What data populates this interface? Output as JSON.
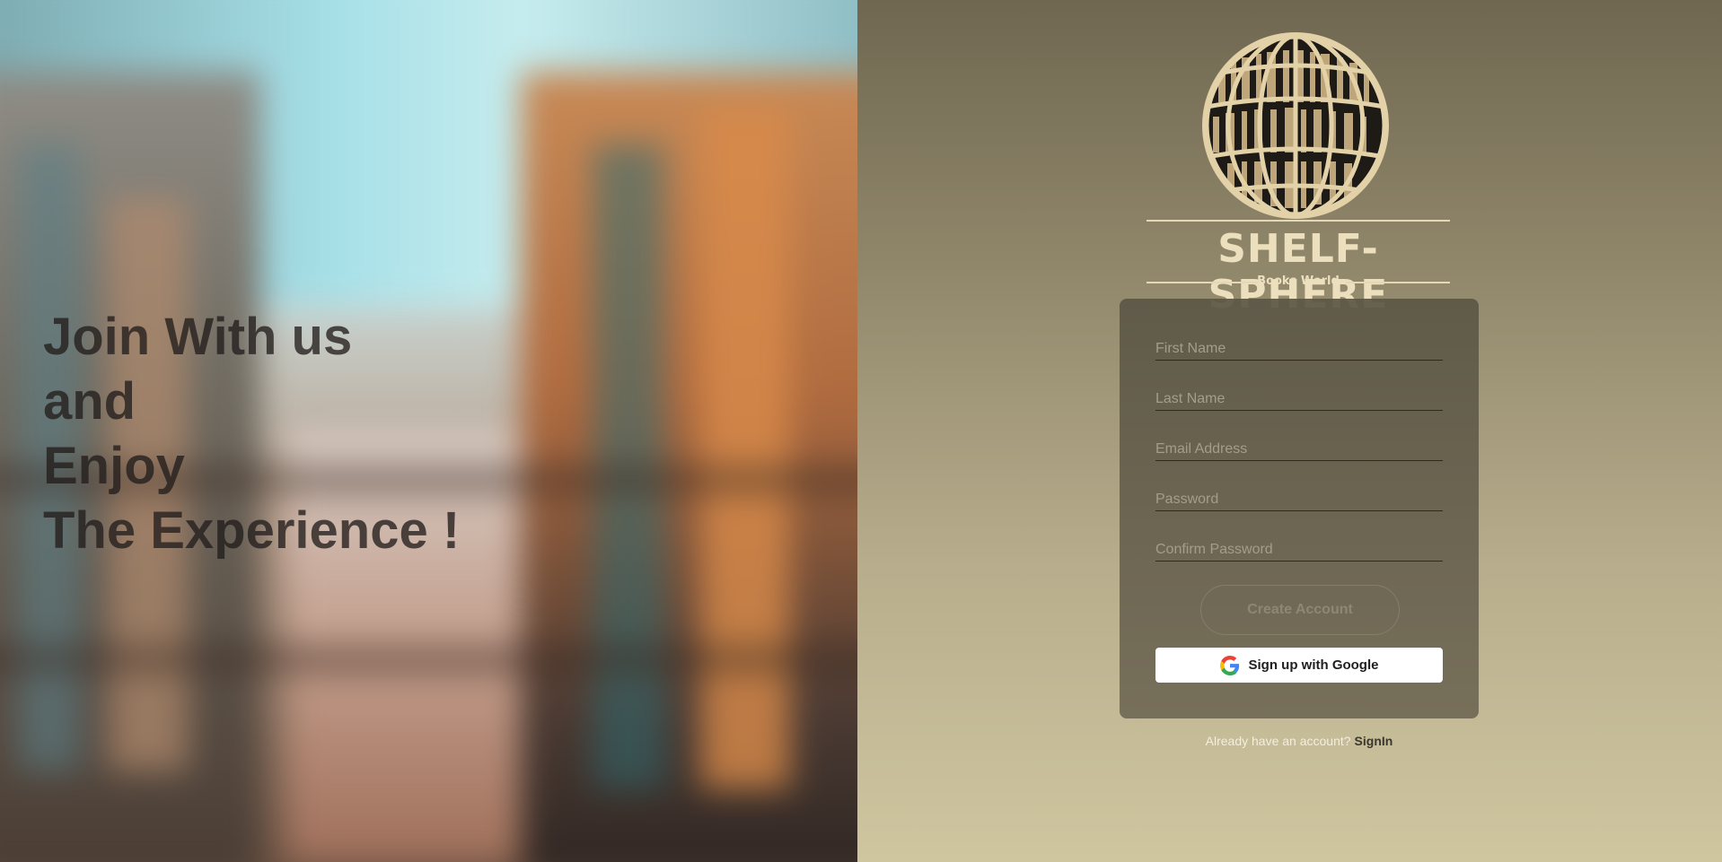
{
  "hero": {
    "lines": [
      "Join With us",
      "and",
      "Enjoy",
      "The Experience !"
    ]
  },
  "brand": {
    "name": "SHELF-SPHERE",
    "tagline": "Books World",
    "logo_icon": "globe-bookshelf-icon"
  },
  "form": {
    "fields": [
      {
        "placeholder": "First Name",
        "value": ""
      },
      {
        "placeholder": "Last Name",
        "value": ""
      },
      {
        "placeholder": "Email Address",
        "value": ""
      },
      {
        "placeholder": "Password",
        "value": ""
      },
      {
        "placeholder": "Confirm Password",
        "value": ""
      }
    ],
    "create_label": "Create Account",
    "google_label": "Sign up with Google",
    "google_icon": "google-icon"
  },
  "footer": {
    "prompt": "Already have an account?",
    "link": "SignIn"
  },
  "colors": {
    "brand_cream": "#ecdfbd",
    "panel_top": "#6f6750",
    "panel_bottom": "#cfc6a0",
    "card_bg": "#5c5646"
  }
}
